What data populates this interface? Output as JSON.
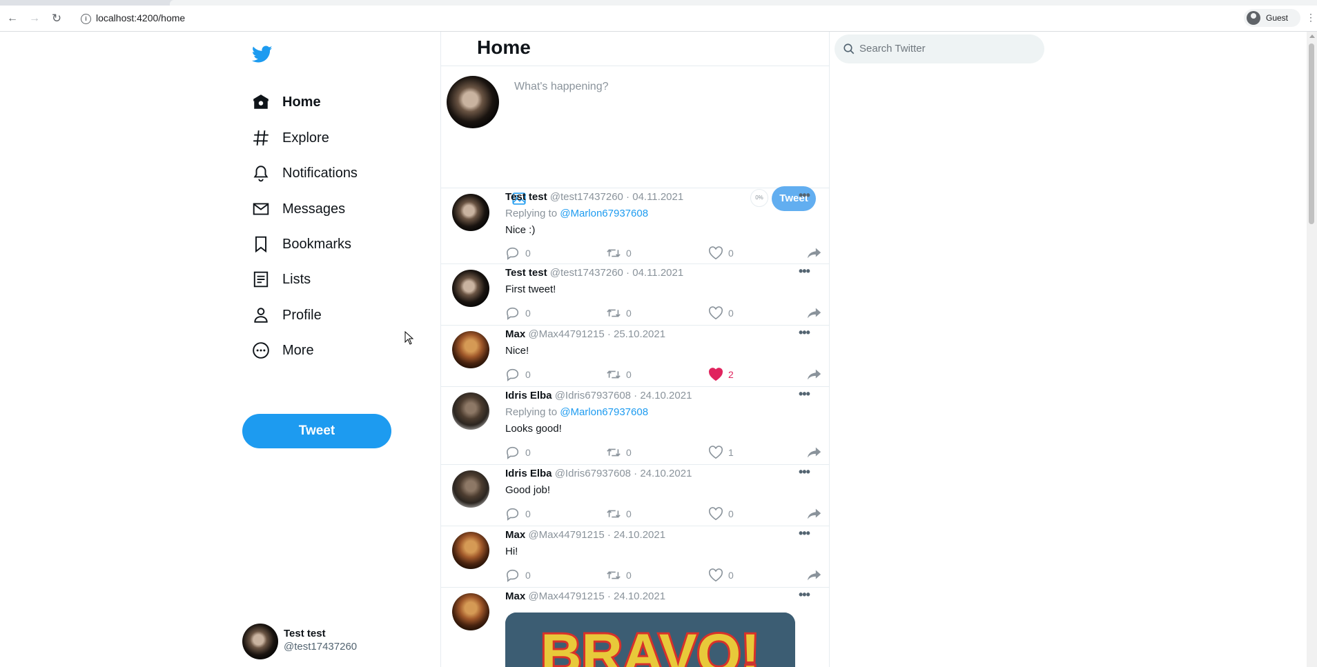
{
  "browser": {
    "url": "localhost:4200/home",
    "profile_label": "Guest"
  },
  "colors": {
    "accent": "#1d9bf0",
    "like": "#e0245e",
    "muted": "#8a939b"
  },
  "sidebar": {
    "logo_icon": "twitter-bird-icon",
    "items": [
      {
        "label": "Home",
        "icon": "home-icon",
        "active": true
      },
      {
        "label": "Explore",
        "icon": "hashtag-icon"
      },
      {
        "label": "Notifications",
        "icon": "bell-icon"
      },
      {
        "label": "Messages",
        "icon": "envelope-icon"
      },
      {
        "label": "Bookmarks",
        "icon": "bookmark-icon"
      },
      {
        "label": "Lists",
        "icon": "list-icon"
      },
      {
        "label": "Profile",
        "icon": "person-icon"
      },
      {
        "label": "More",
        "icon": "more-circle-icon"
      }
    ],
    "tweet_button": "Tweet",
    "account": {
      "name": "Test test",
      "handle": "@test17437260"
    }
  },
  "main": {
    "title": "Home",
    "composer": {
      "placeholder": "What's happening?",
      "progress": "0%",
      "button": "Tweet"
    },
    "tweets": [
      {
        "name": "Test test",
        "meta": "@test17437260 · 04.11.2021",
        "reply_prefix": "Replying to",
        "reply_to": "@Marlon67937608",
        "text": "Nice :)",
        "replies": "0",
        "retweets": "0",
        "likes": "0"
      },
      {
        "name": "Test test",
        "meta": "@test17437260 · 04.11.2021",
        "text": "First tweet!",
        "replies": "0",
        "retweets": "0",
        "likes": "0"
      },
      {
        "name": "Max",
        "meta": "@Max44791215 · 25.10.2021",
        "text": "Nice!",
        "replies": "0",
        "retweets": "0",
        "likes": "2",
        "liked": true
      },
      {
        "name": "Idris Elba",
        "meta": "@Idris67937608 · 24.10.2021",
        "reply_prefix": "Replying to",
        "reply_to": "@Marlon67937608",
        "text": "Looks good!",
        "replies": "0",
        "retweets": "0",
        "likes": "1"
      },
      {
        "name": "Idris Elba",
        "meta": "@Idris67937608 · 24.10.2021",
        "text": "Good job!",
        "replies": "0",
        "retweets": "0",
        "likes": "0"
      },
      {
        "name": "Max",
        "meta": "@Max44791215 · 24.10.2021",
        "text": "Hi!",
        "replies": "0",
        "retweets": "0",
        "likes": "0"
      },
      {
        "name": "Max",
        "meta": "@Max44791215 · 24.10.2021",
        "media_text": "BRAVO!"
      }
    ]
  },
  "search": {
    "placeholder": "Search Twitter"
  }
}
